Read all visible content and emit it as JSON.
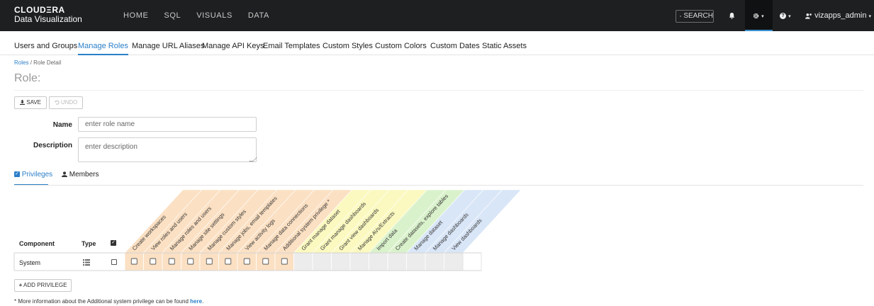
{
  "navbar": {
    "brand_top": "CLOUDΞRA",
    "brand_bottom": "Data Visualization",
    "links": [
      "HOME",
      "SQL",
      "VISUALS",
      "DATA"
    ],
    "search_label": "SEARCH",
    "user_label": "vizapps_admin"
  },
  "admin_tabs": [
    "Users and Groups",
    "Manage Roles",
    "Manage URL Aliases",
    "Manage API Keys",
    "Email Templates",
    "Custom Styles",
    "Custom Colors",
    "Custom Dates",
    "Static Assets"
  ],
  "active_admin_tab": "Manage Roles",
  "breadcrumb": {
    "parent": "Roles",
    "separator": "/",
    "current": "Role Detail"
  },
  "page_title": "Role:",
  "toolbar": {
    "save_label": "SAVE",
    "undo_label": "UNDO"
  },
  "form": {
    "name_label": "Name",
    "name_placeholder": "enter role name",
    "description_label": "Description",
    "description_placeholder": "enter description"
  },
  "sub_tabs": {
    "privileges": "Privileges",
    "members": "Members"
  },
  "grid": {
    "component_header": "Component",
    "type_header": "Type",
    "row_label": "System",
    "privileges": [
      {
        "label": "Create workspaces",
        "group": "system",
        "enabled": true
      },
      {
        "label": "View roles and users",
        "group": "system",
        "enabled": true
      },
      {
        "label": "Manage roles and users",
        "group": "system",
        "enabled": true
      },
      {
        "label": "Manage site settings",
        "group": "system",
        "enabled": true
      },
      {
        "label": "Manage custom styles",
        "group": "system",
        "enabled": true
      },
      {
        "label": "Manage jobs, email templates",
        "group": "system",
        "enabled": true
      },
      {
        "label": "View activity logs",
        "group": "system",
        "enabled": true
      },
      {
        "label": "Manage data connections",
        "group": "system",
        "enabled": true
      },
      {
        "label": "Additional system privilege *",
        "group": "system",
        "enabled": true
      },
      {
        "label": "Grant manage dataset",
        "group": "connection",
        "enabled": false
      },
      {
        "label": "Grant manage dashboards",
        "group": "connection",
        "enabled": false
      },
      {
        "label": "Grant view dashboards",
        "group": "connection",
        "enabled": false
      },
      {
        "label": "Manage AVs/Extracts",
        "group": "connection",
        "enabled": false
      },
      {
        "label": "Import data",
        "group": "data",
        "enabled": false
      },
      {
        "label": "Create datasets, explore tables",
        "group": "data",
        "enabled": false
      },
      {
        "label": "Manage dataset",
        "group": "dataset",
        "enabled": false
      },
      {
        "label": "Manage dashboards",
        "group": "dataset",
        "enabled": false
      },
      {
        "label": "View dashboards",
        "group": "dataset",
        "enabled": false
      }
    ]
  },
  "group_colors": {
    "system": "#fbe0c3",
    "connection": "#fbf9c0",
    "data": "#daf2cc",
    "dataset": "#d9e6f7"
  },
  "add_privilege_label": "ADD PRIVILEGE",
  "footnote": {
    "text": "* More information about the Additional system privilege can be found ",
    "link": "here",
    "end": "."
  }
}
